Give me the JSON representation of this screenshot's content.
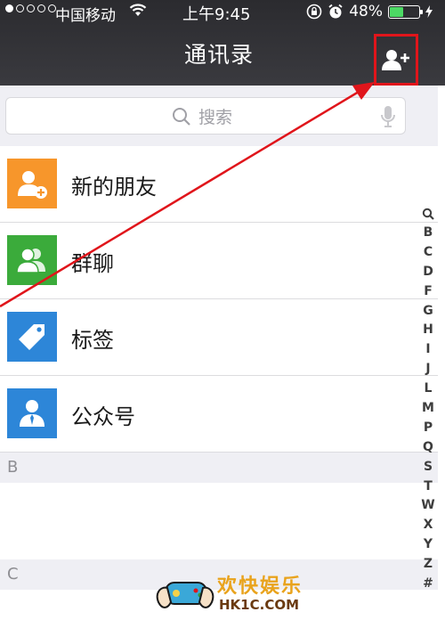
{
  "status_bar": {
    "carrier": "中国移动",
    "time": "上午9:45",
    "battery": "48%",
    "battery_level": 0.48
  },
  "nav": {
    "title": "通讯录",
    "add_icon": "add-contact-icon"
  },
  "search": {
    "placeholder": "搜索"
  },
  "list": {
    "items": [
      {
        "label": "新的朋友",
        "icon": "new-friend-icon",
        "color": "#f7962b"
      },
      {
        "label": "群聊",
        "icon": "group-chat-icon",
        "color": "#3bab3b"
      },
      {
        "label": "标签",
        "icon": "tag-icon",
        "color": "#2d86d8"
      },
      {
        "label": "公众号",
        "icon": "official-account-icon",
        "color": "#2d86d8"
      }
    ],
    "sections": [
      "B",
      "C"
    ]
  },
  "index": [
    "B",
    "C",
    "D",
    "F",
    "G",
    "H",
    "I",
    "J",
    "L",
    "M",
    "P",
    "Q",
    "S",
    "T",
    "W",
    "X",
    "Y",
    "Z",
    "#"
  ],
  "watermark": {
    "title": "欢快娱乐",
    "site": "HK1C.COM"
  },
  "colors": {
    "annotation": "#e0151b",
    "nav_bg": "#2f2f33",
    "page_bg": "#efeff4"
  }
}
